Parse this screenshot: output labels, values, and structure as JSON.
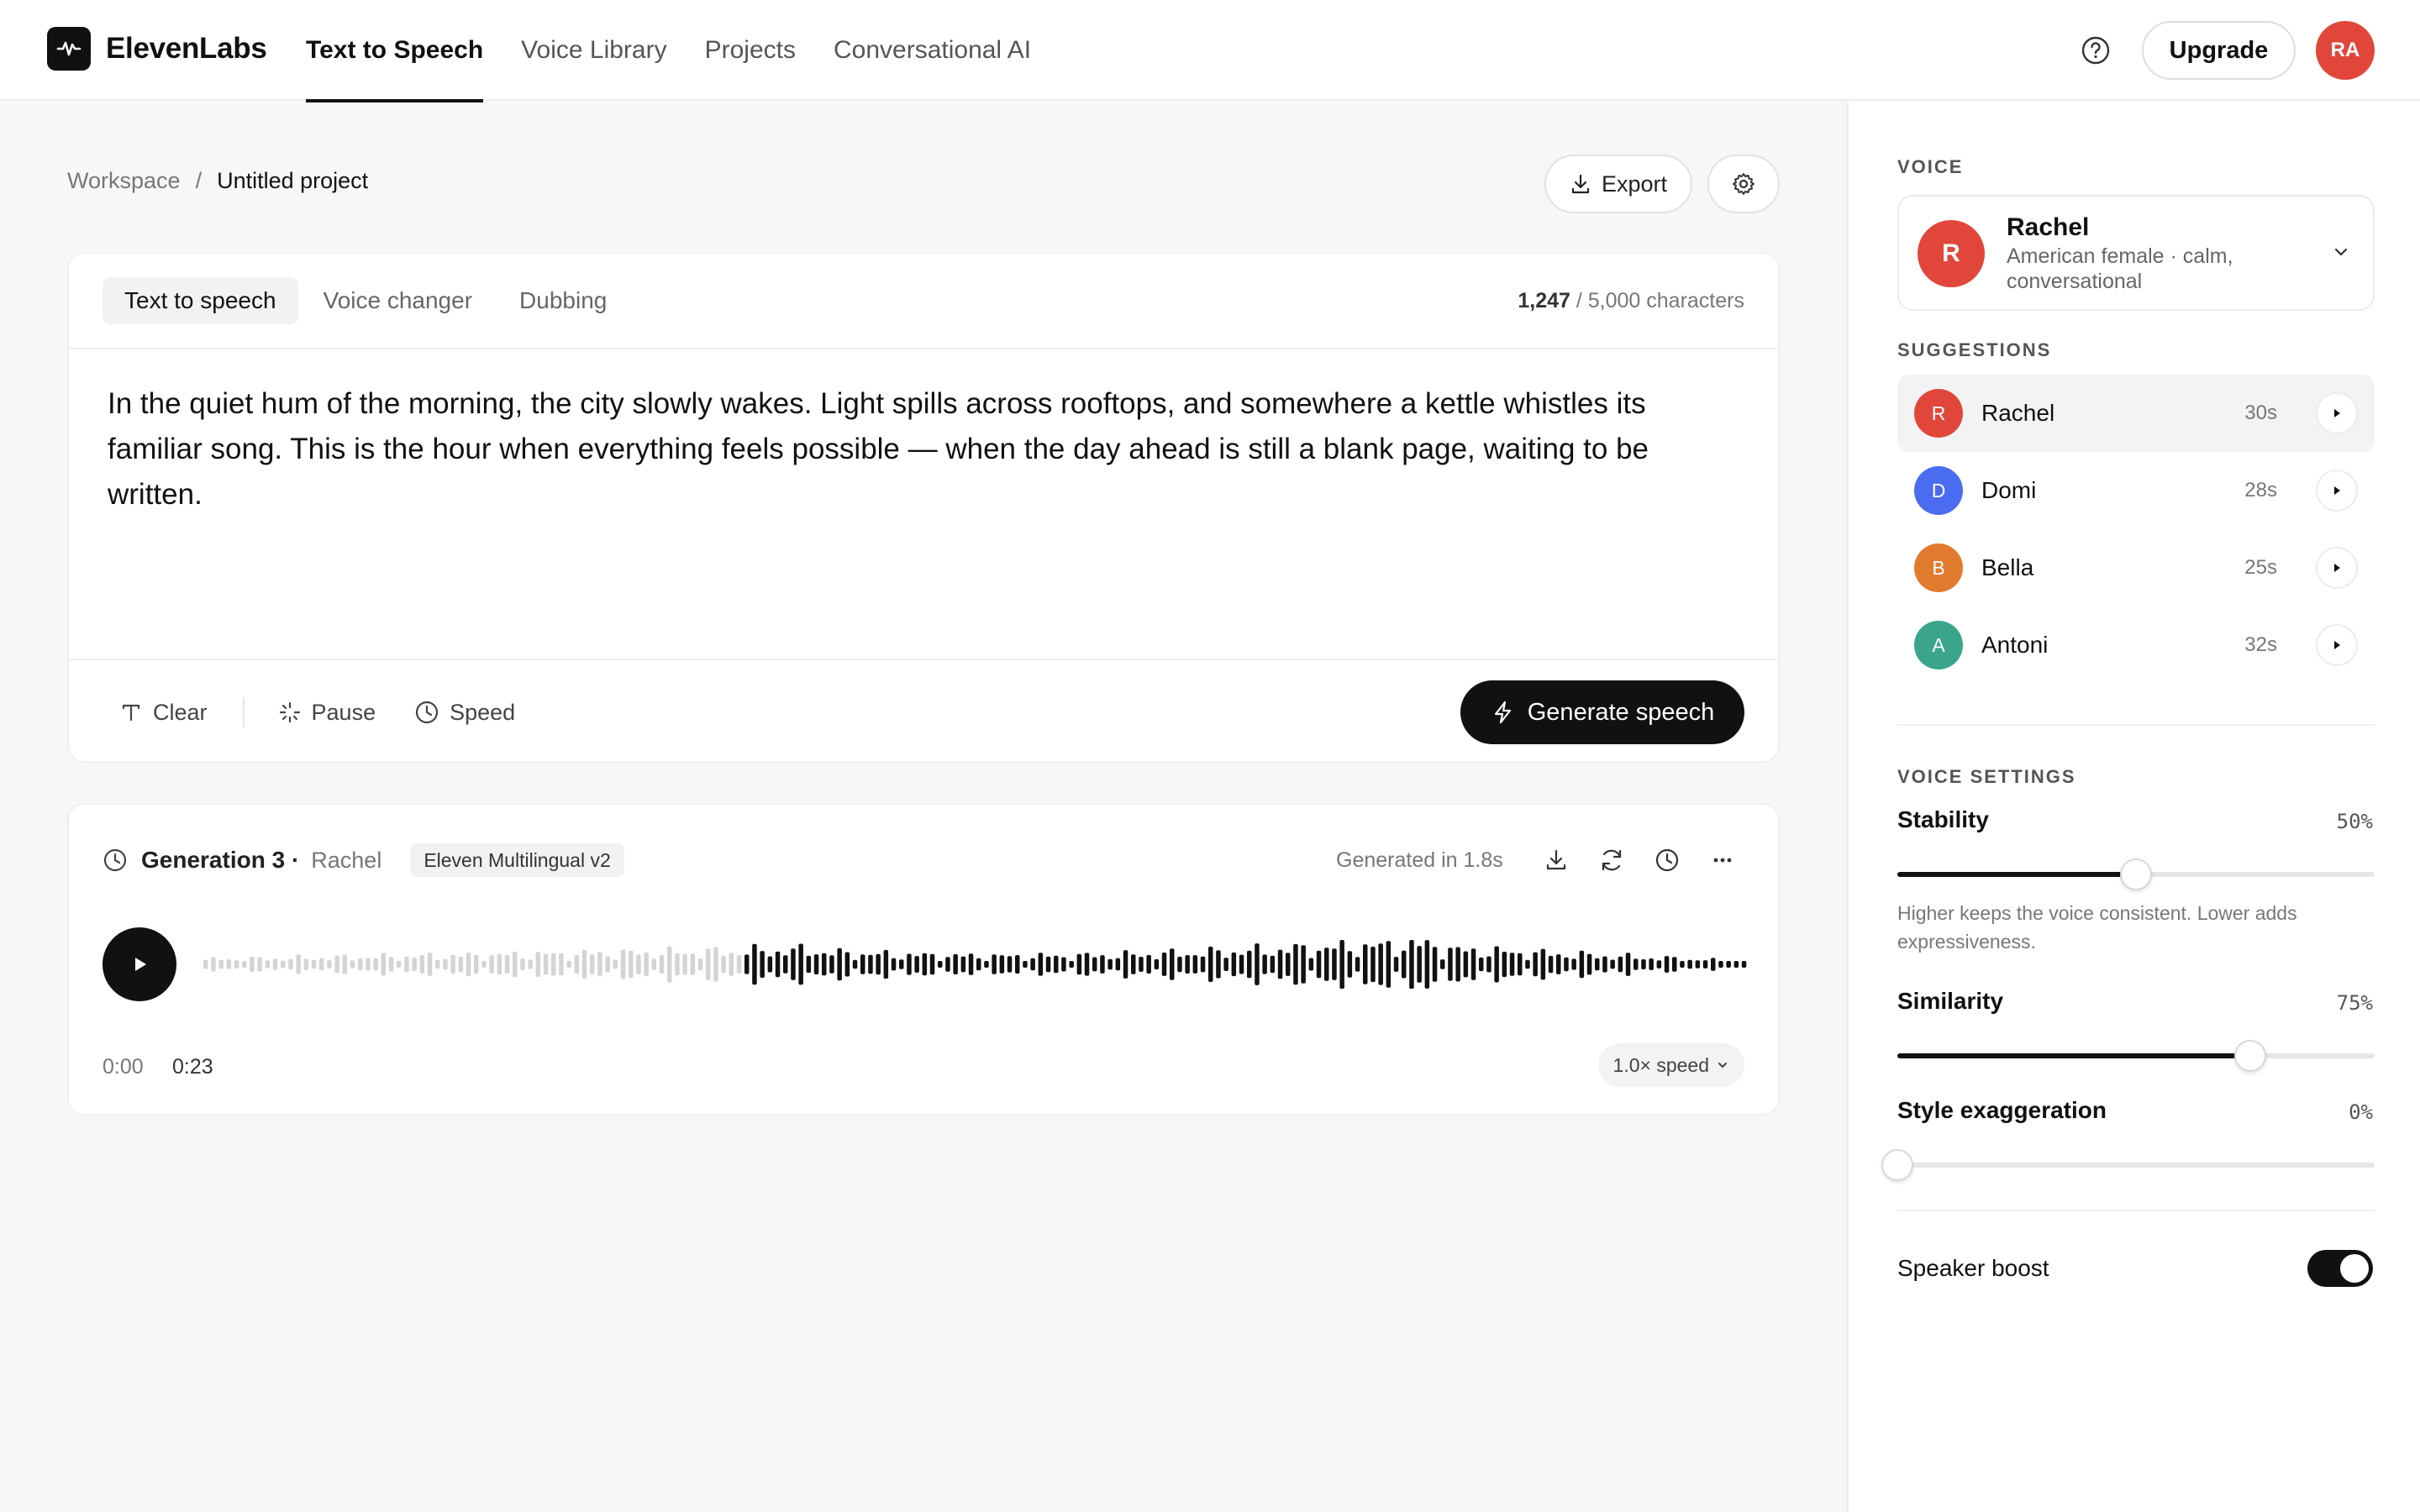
{
  "app": {
    "name": "ElevenLabs",
    "nav": [
      {
        "label": "Text to Speech",
        "active": true
      },
      {
        "label": "Voice Library",
        "active": false
      },
      {
        "label": "Projects",
        "active": false
      },
      {
        "label": "Conversational AI",
        "active": false
      }
    ],
    "upgrade_label": "Upgrade",
    "user_initials": "RA",
    "icons": {
      "logo": "waveform-logo-icon",
      "help": "help-circle-icon"
    }
  },
  "breadcrumb": {
    "root": "Workspace",
    "separator": "/",
    "current": "Untitled project"
  },
  "toolbar": {
    "export_label": "Export"
  },
  "editor": {
    "tabs": [
      {
        "label": "Text to speech",
        "active": true
      },
      {
        "label": "Voice changer",
        "active": false
      },
      {
        "label": "Dubbing",
        "active": false
      }
    ],
    "char_count": "1,247",
    "char_limit": "/ 5,000 characters",
    "text": "In the quiet hum of the morning, the city slowly wakes. Light spills across rooftops, and somewhere a kettle whistles its familiar song. This is the hour when everything feels possible — when the day ahead is still a blank page, waiting to be written.",
    "tools": {
      "clear": "Clear",
      "pause": "Pause",
      "speed": "Speed"
    },
    "generate_label": "Generate speech"
  },
  "generation": {
    "title": "Generation 3 ·",
    "voice": "Rachel",
    "model": "Eleven Multilingual v2",
    "generated_in": "Generated in 1.8s",
    "time_current": "0:00",
    "time_total": "0:23",
    "speed_label": "1.0× speed",
    "progress": 0.0
  },
  "sidebar": {
    "voice_label": "VOICE",
    "selected_voice": {
      "initial": "R",
      "name": "Rachel",
      "description": "American female · calm, conversational",
      "color": "#e0473a"
    },
    "suggestions_label": "SUGGESTIONS",
    "suggestions": [
      {
        "initial": "R",
        "name": "Rachel",
        "duration": "30s",
        "color": "#e0473a",
        "active": true
      },
      {
        "initial": "D",
        "name": "Domi",
        "duration": "28s",
        "color": "#4a6cf0",
        "active": false
      },
      {
        "initial": "B",
        "name": "Bella",
        "duration": "25s",
        "color": "#e07a2e",
        "active": false
      },
      {
        "initial": "A",
        "name": "Antoni",
        "duration": "32s",
        "color": "#3aa58a",
        "active": false
      }
    ],
    "settings_label": "VOICE SETTINGS",
    "stability": {
      "label": "Stability",
      "value_text": "50%",
      "value": 0.5
    },
    "stability_hint": "Higher keeps the voice consistent. Lower adds expressiveness.",
    "similarity": {
      "label": "Similarity",
      "value_text": "75%",
      "value": 0.74
    },
    "style": {
      "label": "Style exaggeration",
      "value_text": "0%",
      "value": 0.0
    },
    "speaker_boost": {
      "label": "Speaker boost",
      "enabled": true
    }
  },
  "colors": {
    "accent": "#111111",
    "avatar_red": "#e0473a"
  }
}
